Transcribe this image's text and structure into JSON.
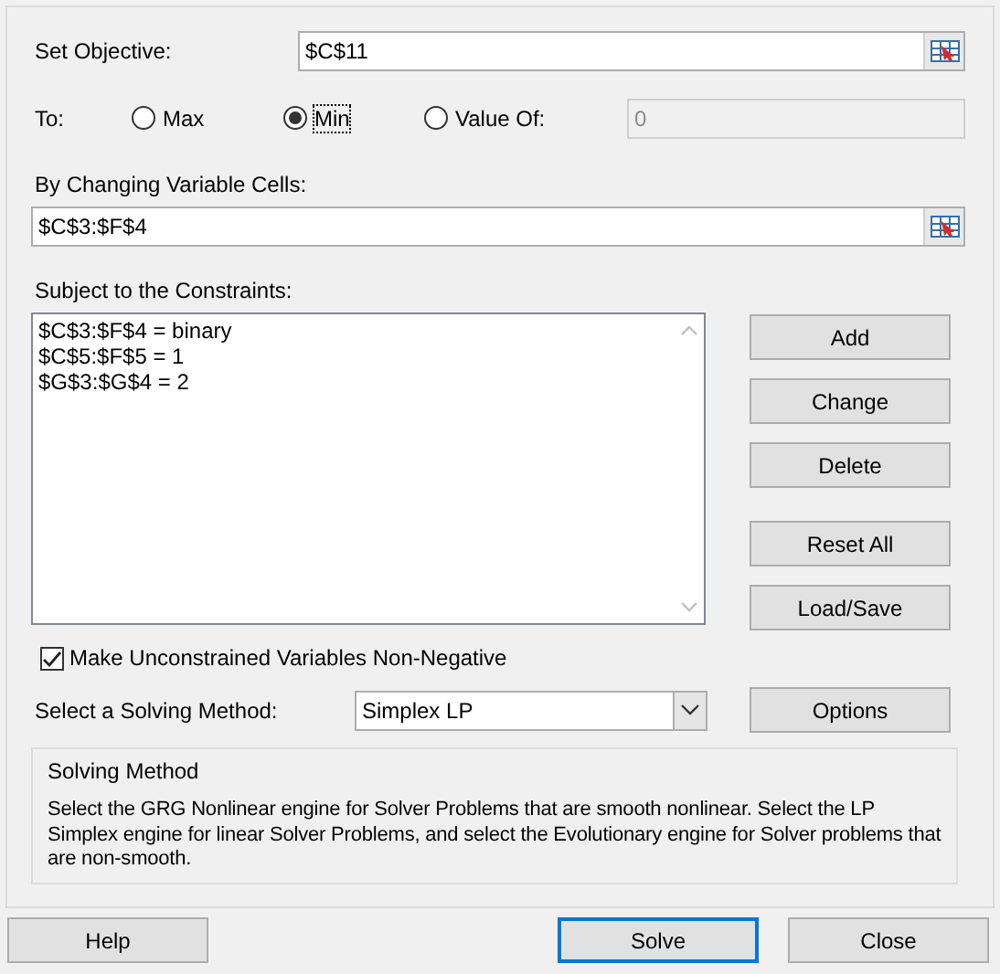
{
  "objective": {
    "label": "Set Objective:",
    "value": "$C$11"
  },
  "to": {
    "label": "To:",
    "options": [
      {
        "label": "Max",
        "selected": false,
        "focused": false
      },
      {
        "label": "Min",
        "selected": true,
        "focused": true
      },
      {
        "label": "Value Of:",
        "selected": false,
        "focused": false
      }
    ],
    "value_of": {
      "value": "0",
      "disabled": true
    }
  },
  "variables": {
    "label": "By Changing Variable Cells:",
    "value": "$C$3:$F$4"
  },
  "constraints": {
    "label": "Subject to the Constraints:",
    "items": [
      "$C$3:$F$4 = binary",
      "$C$5:$F$5 = 1",
      "$G$3:$G$4 = 2"
    ]
  },
  "constraint_buttons": [
    {
      "label": "Add"
    },
    {
      "label": "Change"
    },
    {
      "label": "Delete"
    },
    {
      "label": "Reset All"
    },
    {
      "label": "Load/Save"
    }
  ],
  "non_negative": {
    "label": "Make Unconstrained Variables Non-Negative",
    "checked": true
  },
  "method": {
    "label": "Select a Solving Method:",
    "value": "Simplex LP"
  },
  "options_button": {
    "label": "Options"
  },
  "description": {
    "title": "Solving Method",
    "text": "Select the GRG Nonlinear engine for Solver Problems that are smooth nonlinear. Select the LP Simplex engine for linear Solver Problems, and select the Evolutionary engine for Solver problems that are non-smooth."
  },
  "footer_buttons": [
    {
      "label": "Help",
      "default": false
    },
    {
      "label": "Solve",
      "default": true
    },
    {
      "label": "Close",
      "default": false
    }
  ]
}
